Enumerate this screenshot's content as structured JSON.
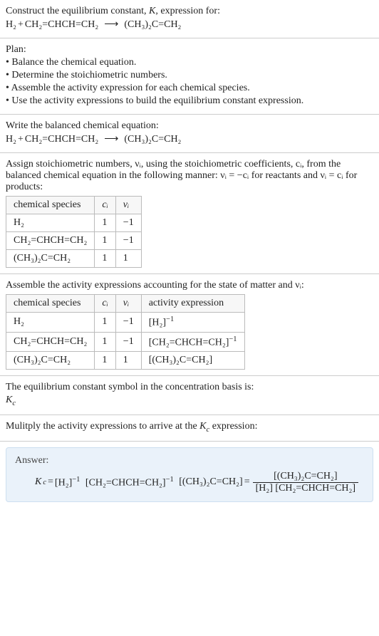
{
  "header": {
    "prompt": "Construct the equilibrium constant, K, expression for:",
    "equation_lhs1": "H₂",
    "plus": " + ",
    "equation_lhs2": "CH₂=CHCH=CH₂",
    "arrow": "⟶",
    "equation_rhs": "(CH₃)₂C=CH₂"
  },
  "plan": {
    "title": "Plan:",
    "b1": "• Balance the chemical equation.",
    "b2": "• Determine the stoichiometric numbers.",
    "b3": "• Assemble the activity expression for each chemical species.",
    "b4": "• Use the activity expressions to build the equilibrium constant expression."
  },
  "balanced": {
    "title": "Write the balanced chemical equation:",
    "lhs1": "H₂",
    "plus": " + ",
    "lhs2": "CH₂=CHCH=CH₂",
    "arrow": "⟶",
    "rhs": "(CH₃)₂C=CH₂"
  },
  "stoich": {
    "intro1": "Assign stoichiometric numbers, νᵢ, using the stoichiometric coefficients, cᵢ, from the balanced chemical equation in the following manner: νᵢ = −cᵢ for reactants and νᵢ = cᵢ for products:",
    "h_species": "chemical species",
    "h_ci": "cᵢ",
    "h_vi": "νᵢ",
    "r1": {
      "sp": "H₂",
      "ci": "1",
      "vi": "−1"
    },
    "r2": {
      "sp": "CH₂=CHCH=CH₂",
      "ci": "1",
      "vi": "−1"
    },
    "r3": {
      "sp": "(CH₃)₂C=CH₂",
      "ci": "1",
      "vi": "1"
    }
  },
  "activity": {
    "intro": "Assemble the activity expressions accounting for the state of matter and νᵢ:",
    "h_species": "chemical species",
    "h_ci": "cᵢ",
    "h_vi": "νᵢ",
    "h_act": "activity expression",
    "r1": {
      "sp": "H₂",
      "ci": "1",
      "vi": "−1",
      "act_base": "[H₂]",
      "act_exp": "−1"
    },
    "r2": {
      "sp": "CH₂=CHCH=CH₂",
      "ci": "1",
      "vi": "−1",
      "act_base": "[CH₂=CHCH=CH₂]",
      "act_exp": "−1"
    },
    "r3": {
      "sp": "(CH₃)₂C=CH₂",
      "ci": "1",
      "vi": "1",
      "act": "[(CH₃)₂C=CH₂]"
    }
  },
  "symbol": {
    "line1": "The equilibrium constant symbol in the concentration basis is:",
    "kc": "K",
    "kc_sub": "c"
  },
  "multiply": {
    "line": "Mulitply the activity expressions to arrive at the Kc expression:"
  },
  "answer": {
    "label": "Answer:",
    "kc": "K",
    "kc_sub": "c",
    "eq": " = ",
    "t1_base": "[H₂]",
    "t1_exp": "−1",
    "t2_base": "[CH₂=CHCH=CH₂]",
    "t2_exp": "−1",
    "t3": "[(CH₃)₂C=CH₂]",
    "eq2": " = ",
    "frac_num": "[(CH₃)₂C=CH₂]",
    "frac_den": "[H₂] [CH₂=CHCH=CH₂]"
  }
}
